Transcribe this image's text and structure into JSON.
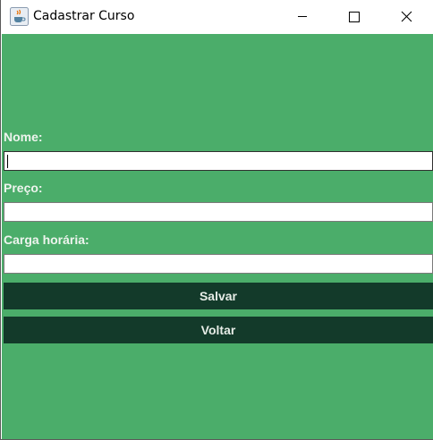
{
  "window": {
    "title": "Cadastrar Curso",
    "app_icon": "java-coffee-icon",
    "controls": {
      "minimize": "minimize-icon",
      "maximize": "maximize-icon",
      "close": "close-icon"
    }
  },
  "form": {
    "nome_label": "Nome:",
    "nome_value": "",
    "preco_label": "Preço:",
    "preco_value": "",
    "carga_label": "Carga horária:",
    "carga_value": ""
  },
  "buttons": {
    "salvar_label": "Salvar",
    "voltar_label": "Voltar"
  },
  "colors": {
    "panel_background": "#4bad6a",
    "button_background": "#133a2a",
    "label_text": "#eef4ee"
  }
}
